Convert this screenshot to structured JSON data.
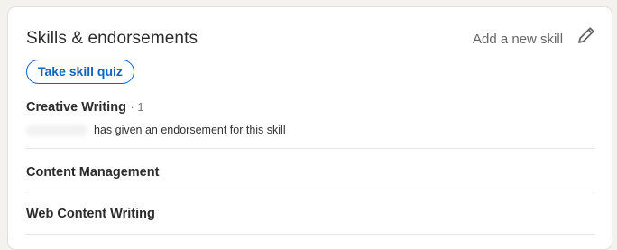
{
  "section": {
    "title": "Skills & endorsements",
    "add_skill_label": "Add a new skill",
    "edit_icon": "pencil-icon",
    "quiz_button_label": "Take skill quiz"
  },
  "skills": [
    {
      "name": "Creative Writing",
      "count_text": "· 1",
      "endorsement_text": "has given an endorsement for this skill"
    },
    {
      "name": "Content Management"
    },
    {
      "name": "Web Content Writing"
    }
  ],
  "colors": {
    "accent": "#0a66c2",
    "background": "#f3f2ef",
    "card": "#ffffff"
  }
}
